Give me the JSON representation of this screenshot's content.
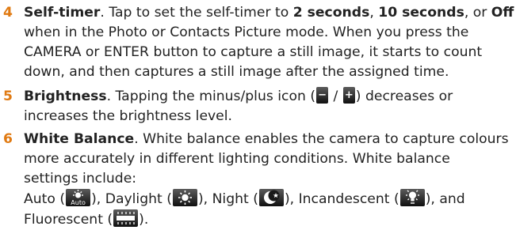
{
  "items": [
    {
      "number": "4",
      "title": "Self-timer",
      "lines": [
        [
          "Self-timer",
          ". Tap to set the self-timer to ",
          "2 seconds",
          ", ",
          "10 seconds",
          ", or ",
          "Off"
        ],
        [
          "when in the Photo or Contacts Picture mode. When you press the"
        ],
        [
          "CAMERA or ENTER button to capture a still image, it starts to count"
        ],
        [
          "down, and then captures a still image after the assigned time."
        ]
      ]
    },
    {
      "number": "5",
      "title": "Brightness",
      "text1": ". Tapping the minus/plus icon (",
      "slash": " / ",
      "text2": ") decreases or",
      "line2": "increases the brightness level.",
      "minus_icon": "minus-icon",
      "plus_icon": "plus-icon"
    },
    {
      "number": "6",
      "title": "White Balance",
      "line1_rest": ". White balance enables the camera to capture colours",
      "line2": "more accurately in different lighting conditions. White balance",
      "line3": "settings include:",
      "modes": [
        {
          "label": "Auto",
          "icon": "auto-wb-icon",
          "icon_text": "Auto"
        },
        {
          "label": "Daylight",
          "icon": "daylight-wb-icon"
        },
        {
          "label": "Night",
          "icon": "night-wb-icon"
        },
        {
          "label": "Incandescent",
          "icon": "incandescent-wb-icon"
        },
        {
          "label": "Fluorescent",
          "icon": "fluorescent-wb-icon"
        }
      ],
      "open_paren": " (",
      "close_sep": "), ",
      "and_text": "), and",
      "close_end": ")."
    }
  ],
  "colors": {
    "number": "#e07a12",
    "text": "#222222",
    "icon_bg": "#1a1a1a"
  }
}
